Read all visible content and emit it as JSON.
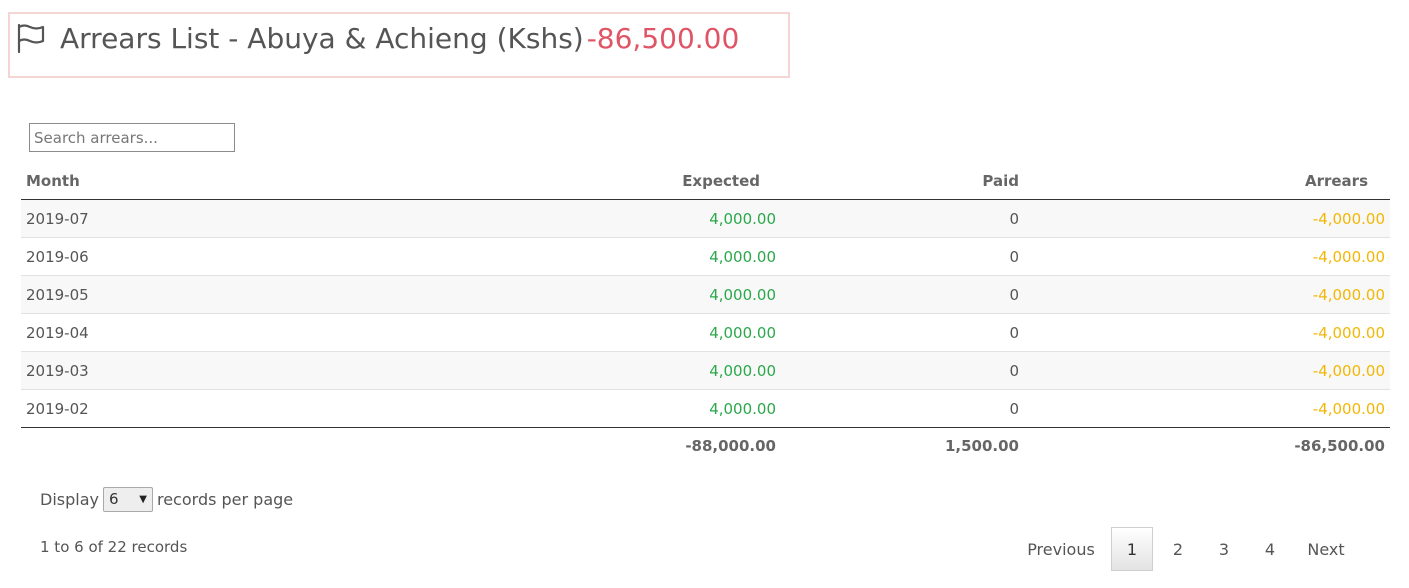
{
  "header": {
    "title": "Arrears List - Abuya & Achieng (Kshs)",
    "total": "-86,500.00"
  },
  "search": {
    "placeholder": "Search arrears..."
  },
  "table": {
    "columns": {
      "month": "Month",
      "expected": "Expected",
      "paid": "Paid",
      "arrears": "Arrears"
    },
    "rows": [
      {
        "month": "2019-07",
        "expected": "4,000.00",
        "paid": "0",
        "arrears": "-4,000.00"
      },
      {
        "month": "2019-06",
        "expected": "4,000.00",
        "paid": "0",
        "arrears": "-4,000.00"
      },
      {
        "month": "2019-05",
        "expected": "4,000.00",
        "paid": "0",
        "arrears": "-4,000.00"
      },
      {
        "month": "2019-04",
        "expected": "4,000.00",
        "paid": "0",
        "arrears": "-4,000.00"
      },
      {
        "month": "2019-03",
        "expected": "4,000.00",
        "paid": "0",
        "arrears": "-4,000.00"
      },
      {
        "month": "2019-02",
        "expected": "4,000.00",
        "paid": "0",
        "arrears": "-4,000.00"
      }
    ],
    "totals": {
      "expected": "-88,000.00",
      "paid": "1,500.00",
      "arrears": "-86,500.00"
    }
  },
  "display": {
    "prefix": "Display",
    "selected": "6",
    "suffix": "records per page"
  },
  "records_info": "1 to 6 of 22 records",
  "pagination": {
    "previous": "Previous",
    "pages": [
      "1",
      "2",
      "3",
      "4"
    ],
    "current": "1",
    "next": "Next"
  },
  "colors": {
    "title_total": "#e05566",
    "expected": "#2aa84a",
    "arrears": "#f2b705",
    "title_border": "#f5d4d4"
  },
  "icons": {
    "title": "flag-icon",
    "select": "caret-down-icon"
  }
}
